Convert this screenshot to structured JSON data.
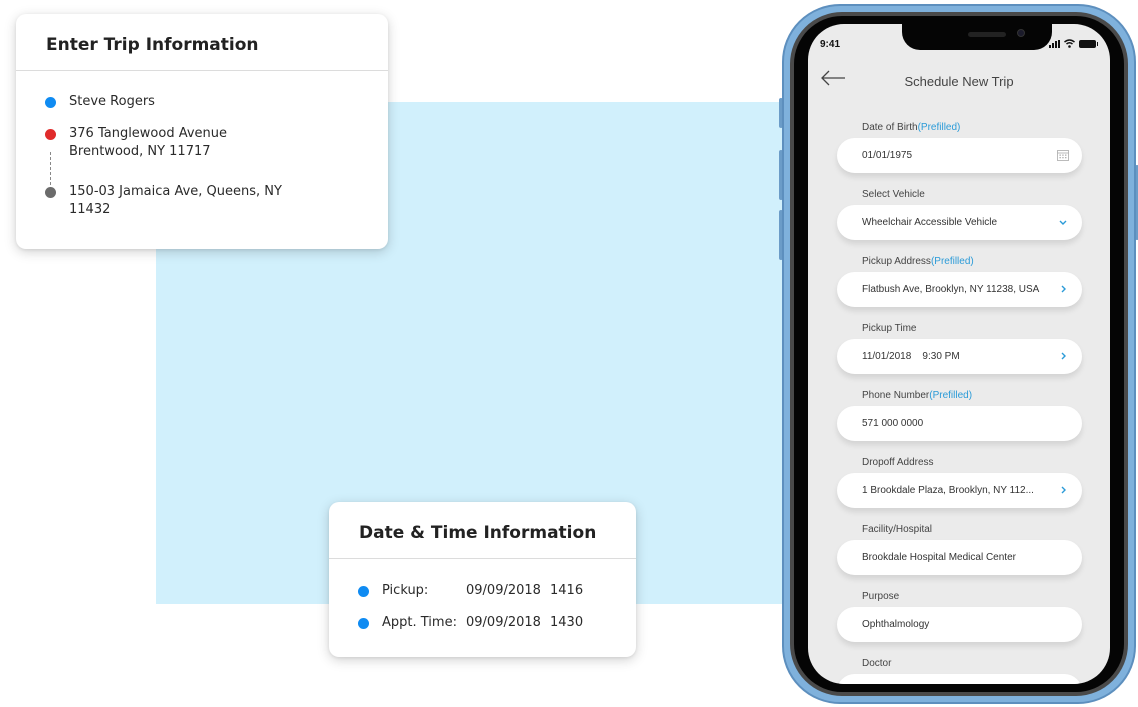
{
  "trip_card": {
    "title": "Enter Trip Information",
    "items": [
      {
        "lines": [
          "Steve Rogers"
        ],
        "dot_color": "#0f8bf2"
      },
      {
        "lines": [
          "376 Tanglewood Avenue",
          "Brentwood, NY 11717"
        ],
        "dot_color": "#e02b2b"
      },
      {
        "lines": [
          "150-03 Jamaica Ave, Queens, NY",
          "11432"
        ],
        "dot_color": "#6b6b6b"
      }
    ]
  },
  "datetime_card": {
    "title": "Date & Time Information",
    "rows": [
      {
        "label": "Pickup:",
        "date": "09/09/2018",
        "time": "1416",
        "dot_color": "#0f8bf2"
      },
      {
        "label": "Appt. Time:",
        "date": "09/09/2018",
        "time": "1430",
        "dot_color": "#0f8bf2"
      }
    ]
  },
  "phone": {
    "status_time": "9:41",
    "status_icons": [
      "signal-icon",
      "wifi-icon",
      "battery-icon"
    ],
    "title": "Schedule New Trip",
    "back_icon": "arrow-left-icon",
    "prefilled_tag": "(Prefilled)",
    "fields": [
      {
        "label": "Date of Birth",
        "prefilled": true,
        "value": "01/01/1975",
        "icon": "calendar-icon"
      },
      {
        "label": "Select Vehicle",
        "prefilled": false,
        "value": "Wheelchair Accessible Vehicle",
        "icon": "chevron-down-icon"
      },
      {
        "label": "Pickup Address",
        "prefilled": true,
        "value": "Flatbush Ave, Brooklyn, NY 11238, USA",
        "icon": "chevron-right-icon"
      },
      {
        "label": "Pickup Time",
        "prefilled": false,
        "value": "11/01/2018    9:30 PM",
        "icon": "chevron-right-icon"
      },
      {
        "label": "Phone Number",
        "prefilled": true,
        "value": "571 000 0000",
        "icon": ""
      },
      {
        "label": "Dropoff Address",
        "prefilled": false,
        "value": "1 Brookdale Plaza, Brooklyn, NY 112...",
        "icon": "chevron-right-icon"
      },
      {
        "label": "Facility/Hospital",
        "prefilled": false,
        "value": "Brookdale Hospital Medical Center",
        "icon": ""
      },
      {
        "label": "Purpose",
        "prefilled": false,
        "value": "Ophthalmology",
        "icon": ""
      },
      {
        "label": "Doctor",
        "prefilled": false,
        "value": "",
        "icon": ""
      }
    ],
    "accent": "#2b9bd8"
  }
}
